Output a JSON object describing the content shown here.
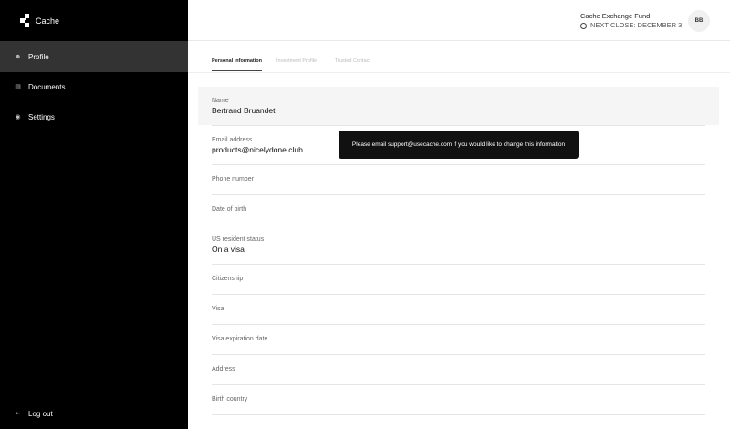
{
  "app": {
    "name": "Cache"
  },
  "sidebar": {
    "items": [
      {
        "label": "Profile",
        "icon": "user-icon"
      },
      {
        "label": "Documents",
        "icon": "document-icon"
      },
      {
        "label": "Settings",
        "icon": "gear-icon"
      }
    ],
    "logout": "Log out"
  },
  "header": {
    "fund": "Cache Exchange Fund",
    "next_close": "NEXT CLOSE: DECEMBER 3",
    "avatar": "BB"
  },
  "tabs": [
    "Personal Information",
    "Investment Profile",
    "Trusted Contact"
  ],
  "fields": [
    {
      "label": "Name",
      "value": "Bertrand Bruandet"
    },
    {
      "label": "Email address",
      "value": "products@nicelydone.club"
    },
    {
      "label": "Phone number",
      "value": ""
    },
    {
      "label": "Date of birth",
      "value": ""
    },
    {
      "label": "US resident status",
      "value": "On a visa"
    },
    {
      "label": "Citizenship",
      "value": ""
    },
    {
      "label": "Visa",
      "value": ""
    },
    {
      "label": "Visa expiration date",
      "value": ""
    },
    {
      "label": "Address",
      "value": ""
    },
    {
      "label": "Birth country",
      "value": ""
    }
  ],
  "tooltip": "Please email support@usecache.com if you would like to change this information"
}
